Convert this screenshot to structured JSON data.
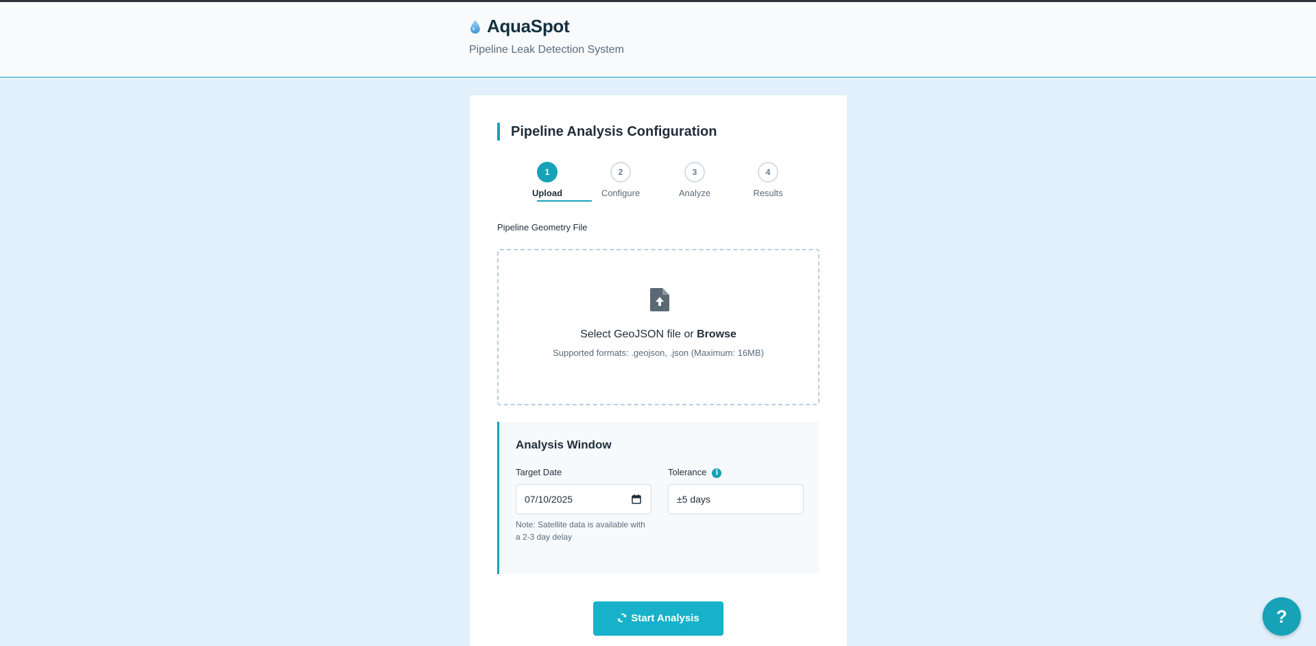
{
  "header": {
    "title": "AquaSpot",
    "subtitle": "Pipeline Leak Detection System",
    "logo_icon": "water-drop-icon"
  },
  "card": {
    "title": "Pipeline Analysis Configuration"
  },
  "stepper": {
    "steps": [
      {
        "number": "1",
        "label": "Upload",
        "state": "active"
      },
      {
        "number": "2",
        "label": "Configure",
        "state": "pending"
      },
      {
        "number": "3",
        "label": "Analyze",
        "state": "pending"
      },
      {
        "number": "4",
        "label": "Results",
        "state": "pending"
      }
    ]
  },
  "upload": {
    "label": "Pipeline Geometry File",
    "prompt": "Select GeoJSON file or ",
    "browse": "Browse",
    "formats": "Supported formats: .geojson, .json (Maximum: 16MB)",
    "icon": "file-upload-icon"
  },
  "analysis_window": {
    "title": "Analysis Window",
    "target_date_label": "Target Date",
    "target_date_value": "07/10/2025",
    "tolerance_label": "Tolerance",
    "tolerance_value": "±5 days",
    "note": "Note: Satellite data is available with a 2-3 day delay"
  },
  "actions": {
    "start_label": "Start Analysis",
    "help_label": "?"
  },
  "colors": {
    "accent": "#17a2b8",
    "button": "#17b1c9",
    "page_bg": "#e1f0fa"
  }
}
